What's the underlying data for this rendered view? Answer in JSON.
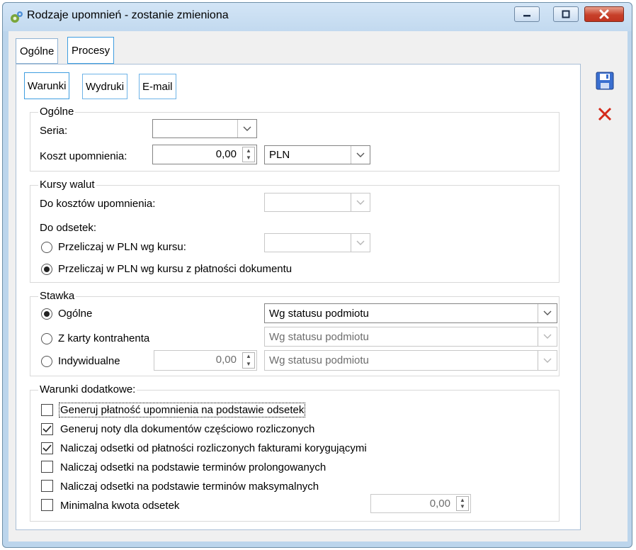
{
  "window": {
    "title": "Rodzaje upomnień - zostanie zmieniona"
  },
  "outer_tabs": [
    "Ogólne",
    "Procesy"
  ],
  "inner_tabs": [
    "Warunki",
    "Wydruki",
    "E-mail"
  ],
  "general": {
    "legend": "Ogólne",
    "seria_label": "Seria:",
    "seria_value": "",
    "koszt_label": "Koszt upomnienia:",
    "koszt_value": "0,00",
    "currency": "PLN"
  },
  "rates": {
    "legend": "Kursy walut",
    "costs_label": "Do kosztów upomnienia:",
    "interest_label": "Do odsetek:",
    "option1": "Przeliczaj w PLN wg kursu:",
    "option2": "Przeliczaj w PLN wg kursu z płatności dokumentu"
  },
  "stawka": {
    "legend": "Stawka",
    "option1": "Ogólne",
    "option2": "Z karty kontrahenta",
    "option3": "Indywidualne",
    "ind_value": "0,00",
    "combo1": "Wg statusu podmiotu",
    "combo2": "Wg statusu podmiotu",
    "combo3": "Wg statusu podmiotu"
  },
  "extra": {
    "legend": "Warunki dodatkowe:",
    "items": [
      {
        "label": "Generuj płatność upomnienia na podstawie odsetek",
        "checked": false
      },
      {
        "label": "Generuj noty dla dokumentów częściowo rozliczonych",
        "checked": true
      },
      {
        "label": "Naliczaj odsetki od płatności rozliczonych fakturami korygującymi",
        "checked": true
      },
      {
        "label": "Naliczaj odsetki na podstawie terminów prolongowanych",
        "checked": false
      },
      {
        "label": "Naliczaj odsetki na podstawie terminów maksymalnych",
        "checked": false
      },
      {
        "label": "Minimalna kwota odsetek",
        "checked": false
      }
    ],
    "min_value": "0,00"
  },
  "icons": [
    "gear-app-icon",
    "minimize-icon",
    "maximize-icon",
    "close-icon",
    "save-icon",
    "cancel-icon",
    "chevron-down-icon",
    "spin-arrows-icon",
    "checkmark-icon"
  ],
  "colors": {
    "titlebar": "#c8ddf2",
    "close_button": "#c7402a",
    "tab_border": "#3f9ee0",
    "cancel_x": "#d42a1a",
    "save_blue": "#3a6fd0"
  }
}
